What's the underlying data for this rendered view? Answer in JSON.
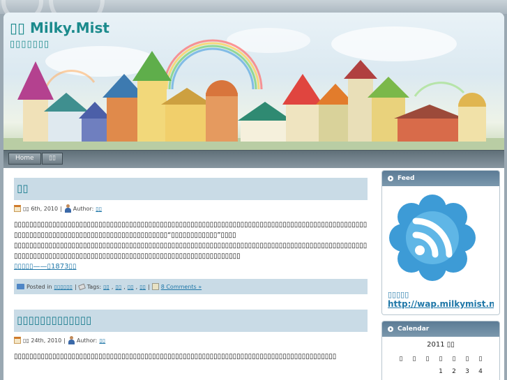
{
  "header": {
    "title": "▯▯ Milky.Mist",
    "description": "▯▯▯▯▯▯▯"
  },
  "nav": {
    "items": [
      {
        "label": "Home"
      },
      {
        "label": "▯▯"
      }
    ]
  },
  "posts": [
    {
      "title": "▯▯",
      "date": "▯▯ 6th, 2010",
      "author_label": "Author:",
      "author": "▯▯",
      "body_1": "▯▯▯▯▯▯▯▯▯▯▯▯▯▯▯▯▯▯▯▯▯▯▯▯▯▯▯▯▯▯▯▯▯▯▯▯▯▯▯▯▯▯▯▯▯▯▯▯▯▯▯▯▯▯▯▯▯▯▯▯▯▯▯▯▯▯▯▯▯▯▯▯▯▯▯▯▯▯▯▯▯▯▯▯▯▯▯▯▯▯▯▯▯▯▯▯▯▯▯▯▯▯▯▯▯▯▯▯▯▯▯▯▯▯▯▯▯▯▯▯▯▯▯▯▯▯▯▯▯▯▯▯“▯▯▯▯▯▯▯▯▯▯▯▯”▯▯▯▯",
      "body_2": "▯▯▯▯▯▯▯▯▯▯▯▯▯▯▯▯▯▯▯▯▯▯▯▯▯▯▯▯▯▯▯▯▯▯▯▯▯▯▯▯▯▯▯▯▯▯▯▯▯▯▯▯▯▯▯▯▯▯▯▯▯▯▯▯▯▯▯▯▯▯▯▯▯▯▯▯▯▯▯▯▯▯▯▯▯▯▯▯▯▯▯▯▯▯▯▯▯▯▯▯▯▯▯▯▯▯▯▯▯▯▯▯▯▯▯▯▯▯▯▯▯▯▯▯▯▯▯▯▯▯▯▯▯▯▯▯▯▯▯▯▯▯▯▯▯▯▯▯▯▯▯",
      "read_more": "▯▯▯▯▯——▯1873▯▯",
      "posted_in_label": "Posted in",
      "category": "▯▯▯▯▯▯",
      "tags_label": "Tags:",
      "tags": [
        "▯▯",
        "▯▯",
        "▯▯",
        "▯▯"
      ],
      "comments": "8 Comments »"
    },
    {
      "title": "▯▯▯▯▯▯▯▯▯▯▯▯▯",
      "date": "▯▯ 24th, 2010",
      "author_label": "Author:",
      "author": "▯▯",
      "body_1": "▯▯▯▯▯▯▯▯▯▯▯▯▯▯▯▯▯▯▯▯▯▯▯▯▯▯▯▯▯▯▯▯▯▯▯▯▯▯▯▯▯▯▯▯▯▯▯▯▯▯▯▯▯▯▯▯▯▯▯▯▯▯▯▯▯▯▯▯▯▯▯▯▯▯▯▯▯▯▯▯▯▯▯▯"
    }
  ],
  "sidebar": {
    "feed": {
      "title": "Feed",
      "label": "▯▯▯▯▯",
      "url": "http://wap.milkymist.net"
    },
    "calendar": {
      "title": "Calendar",
      "caption": "2011 ▯▯",
      "weekdays": [
        "▯",
        "▯",
        "▯",
        "▯",
        "▯",
        "▯",
        "▯"
      ],
      "first_row": [
        "",
        "",
        "",
        "1",
        "2",
        "3",
        "4"
      ]
    }
  },
  "colors": {
    "accent": "#1b8a8c",
    "link": "#1f77a8",
    "title_bar": "#c9dbe6",
    "nav": "#6d7c85",
    "widget_title": "#5b7b95"
  }
}
